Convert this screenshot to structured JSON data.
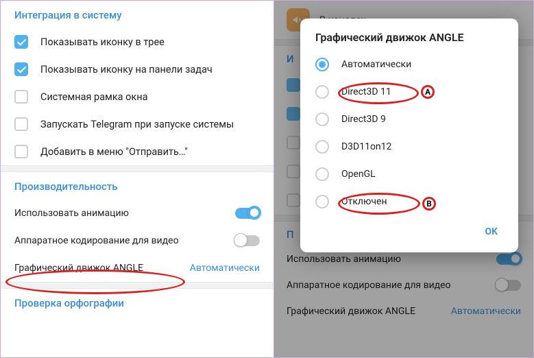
{
  "left": {
    "integration_header": "Интеграция в систему",
    "items": [
      {
        "label": "Показывать иконку в трее",
        "checked": true
      },
      {
        "label": "Показывать иконку на панели задач",
        "checked": true
      },
      {
        "label": "Системная рамка окна",
        "checked": false
      },
      {
        "label": "Запускать Telegram при запуске системы",
        "checked": false
      },
      {
        "label": "Добавить в меню \"Отправить…\"",
        "checked": false
      }
    ],
    "performance_header": "Производительность",
    "perf_rows": {
      "animation": {
        "label": "Использовать анимацию",
        "on": true
      },
      "hwenc": {
        "label": "Аппаратное кодирование для видео",
        "on": false
      },
      "angle": {
        "label": "Графический движок ANGLE",
        "value": "Автоматически"
      }
    },
    "spellcheck_header": "Проверка орфографии"
  },
  "right_bg": {
    "channels_label": "В каналах",
    "section_i_letter": "И",
    "section_p_letter": "П",
    "anim_label": "Использовать анимацию",
    "hwenc_label": "Аппаратное кодирование для видео",
    "angle_label": "Графический движок ANGLE",
    "angle_value": "Автоматически"
  },
  "modal": {
    "title": "Графический движок ANGLE",
    "options": [
      {
        "label": "Автоматически",
        "selected": true
      },
      {
        "label": "Direct3D 11",
        "selected": false
      },
      {
        "label": "Direct3D 9",
        "selected": false
      },
      {
        "label": "D3D11on12",
        "selected": false
      },
      {
        "label": "OpenGL",
        "selected": false
      },
      {
        "label": "Отключен",
        "selected": false
      }
    ],
    "ok": "OK"
  },
  "badges": {
    "a": "A",
    "b": "B"
  }
}
